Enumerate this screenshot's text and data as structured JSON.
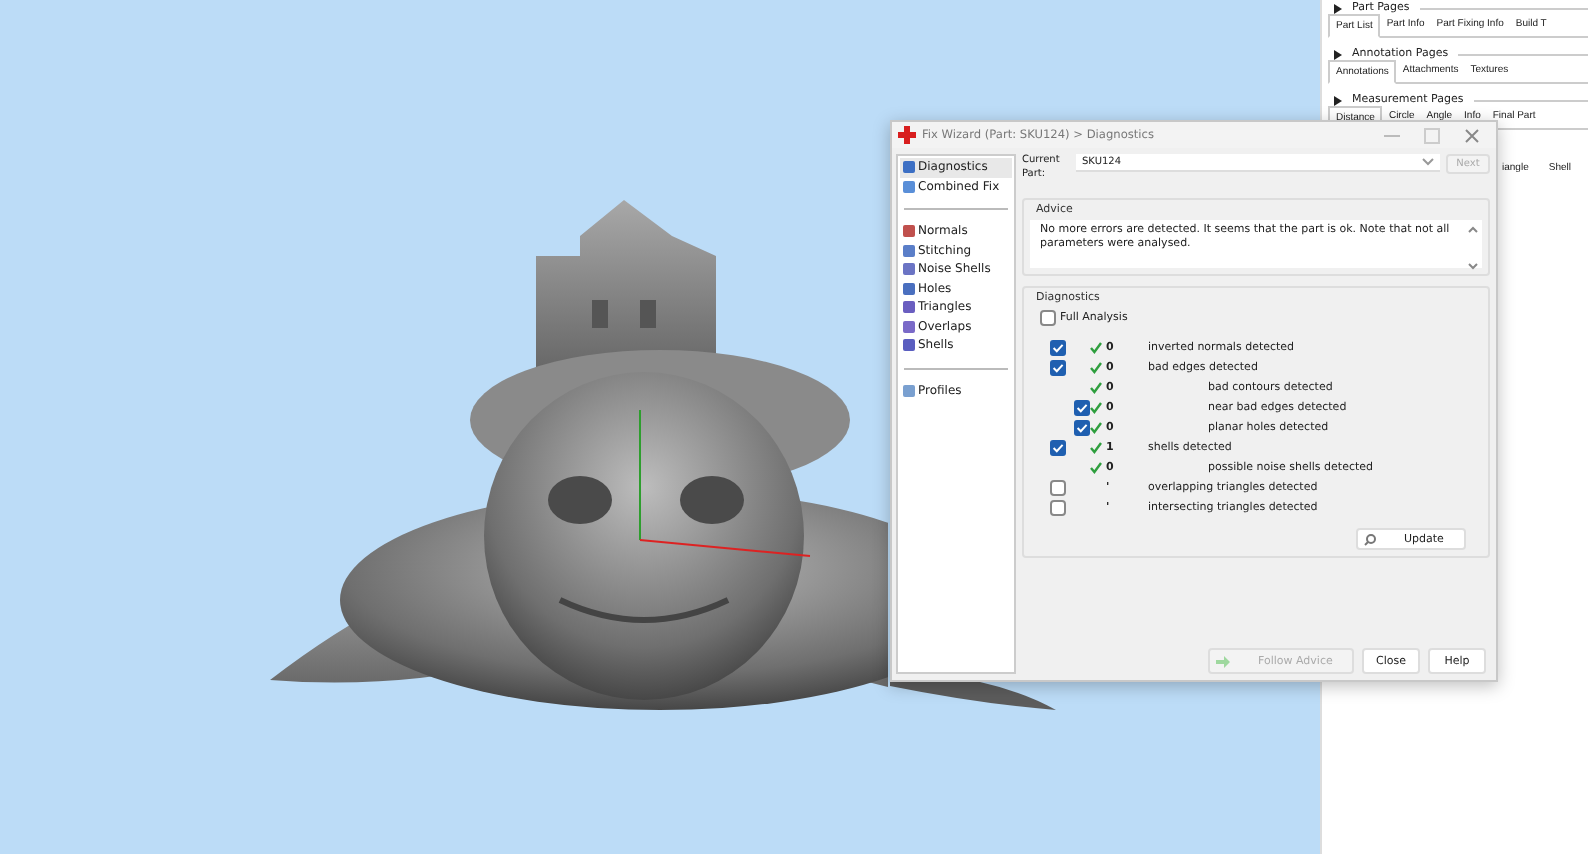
{
  "side_panel": {
    "sections": [
      {
        "title": "Part Pages",
        "tabs": [
          {
            "label": "Part List",
            "selected": true
          },
          {
            "label": "Part Info",
            "selected": false
          },
          {
            "label": "Part Fixing Info",
            "selected": false
          },
          {
            "label": "Build T",
            "selected": false
          }
        ]
      },
      {
        "title": "Annotation Pages",
        "tabs": [
          {
            "label": "Annotations",
            "selected": true
          },
          {
            "label": "Attachments",
            "selected": false
          },
          {
            "label": "Textures",
            "selected": false
          }
        ]
      },
      {
        "title": "Measurement Pages",
        "tabs": [
          {
            "label": "Distance",
            "selected": true
          },
          {
            "label": "Circle",
            "selected": false
          },
          {
            "label": "Angle",
            "selected": false
          },
          {
            "label": "Info",
            "selected": false
          },
          {
            "label": "Final Part",
            "selected": false
          }
        ]
      }
    ],
    "sub_tabs": [
      {
        "label": "iangle",
        "selected": false
      },
      {
        "label": "Shell",
        "selected": false
      }
    ]
  },
  "dialog": {
    "title": "Fix Wizard (Part: SKU124) > Diagnostics",
    "nav_groups": [
      [
        {
          "label": "Diagnostics",
          "selected": true
        },
        {
          "label": "Combined Fix",
          "selected": false
        }
      ],
      [
        {
          "label": "Normals",
          "selected": false
        },
        {
          "label": "Stitching",
          "selected": false
        },
        {
          "label": "Noise Shells",
          "selected": false
        },
        {
          "label": "Holes",
          "selected": false
        },
        {
          "label": "Triangles",
          "selected": false
        },
        {
          "label": "Overlaps",
          "selected": false
        },
        {
          "label": "Shells",
          "selected": false
        }
      ],
      [
        {
          "label": "Profiles",
          "selected": false
        }
      ]
    ],
    "current_part": {
      "label": "Current Part:",
      "value": "SKU124"
    },
    "next_button": {
      "label": "Next",
      "disabled": true
    },
    "advice": {
      "title": "Advice",
      "text": "No more errors are detected. It seems that the part is ok. Note that not all parameters were analysed."
    },
    "diagnostics": {
      "title": "Diagnostics",
      "full_analysis": {
        "label": "Full Analysis",
        "checked": false
      },
      "items": [
        {
          "checked": true,
          "passed": true,
          "count": "0",
          "label": "inverted normals detected"
        },
        {
          "checked": true,
          "passed": true,
          "count": "0",
          "label": "bad edges detected",
          "children": [
            {
              "passed": true,
              "count": "0",
              "label": "bad contours detected"
            },
            {
              "checked": true,
              "passed": true,
              "count": "0",
              "label": "near bad edges detected"
            },
            {
              "checked": true,
              "passed": true,
              "count": "0",
              "label": "planar holes detected"
            }
          ]
        },
        {
          "checked": true,
          "passed": true,
          "count": "1",
          "label": "shells detected",
          "children": [
            {
              "passed": true,
              "count": "0",
              "label": "possible noise shells detected"
            }
          ]
        },
        {
          "checked": false,
          "passed": false,
          "count": "'",
          "label": "overlapping triangles detected"
        },
        {
          "checked": false,
          "passed": false,
          "count": "'",
          "label": "intersecting triangles detected"
        }
      ],
      "update_button": "Update"
    },
    "buttons": [
      {
        "label": "Follow Advice",
        "disabled": true,
        "kind": "advice"
      },
      {
        "label": "Close",
        "disabled": false,
        "kind": "plain"
      },
      {
        "label": "Help",
        "disabled": false,
        "kind": "plain"
      }
    ]
  }
}
